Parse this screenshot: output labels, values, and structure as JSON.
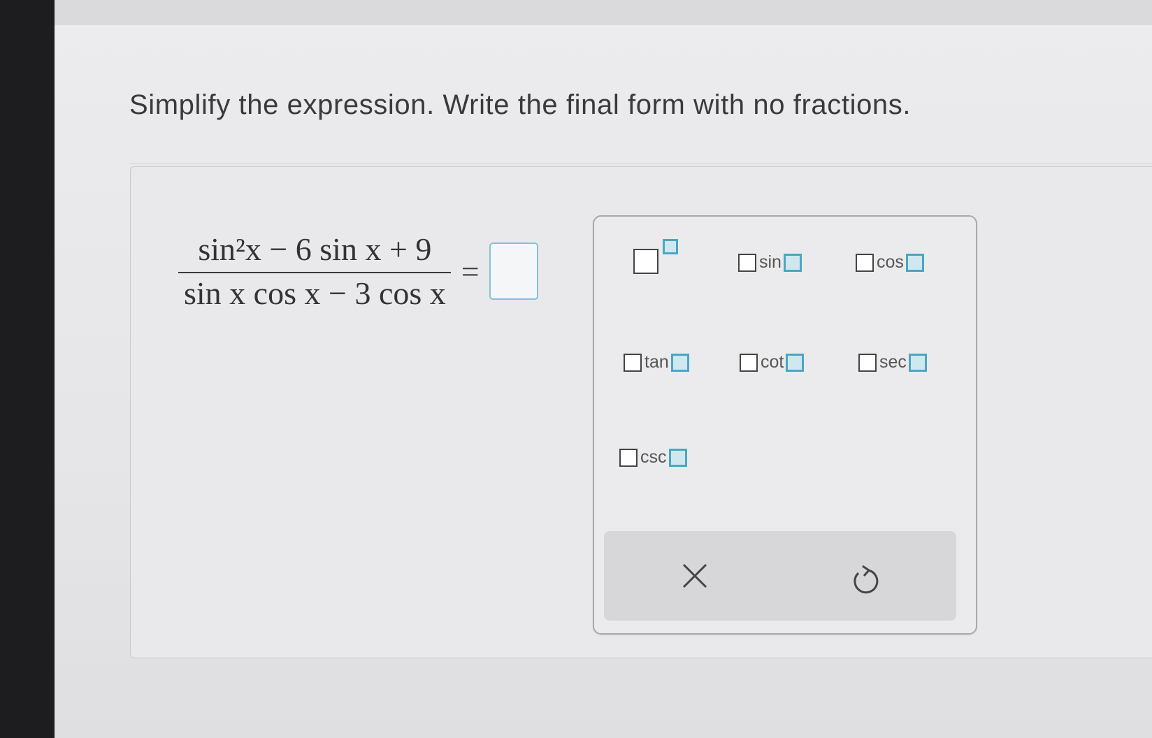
{
  "question": {
    "prompt": "Simplify the expression. Write the final form with no fractions."
  },
  "expression": {
    "numerator": "sin²x − 6 sin x + 9",
    "denominator": "sin x cos x − 3 cos x",
    "equals": "=",
    "answer_value": ""
  },
  "palette": {
    "keys": [
      {
        "id": "power",
        "label": ""
      },
      {
        "id": "sin",
        "label": "sin"
      },
      {
        "id": "cos",
        "label": "cos"
      },
      {
        "id": "tan",
        "label": "tan"
      },
      {
        "id": "cot",
        "label": "cot"
      },
      {
        "id": "sec",
        "label": "sec"
      },
      {
        "id": "csc",
        "label": "csc"
      }
    ],
    "actions": [
      {
        "id": "clear",
        "icon": "close-icon"
      },
      {
        "id": "undo",
        "icon": "undo-icon"
      }
    ]
  },
  "colors": {
    "input_border": "#7fc3d6",
    "slot_fill": "#cfe7ef",
    "slot_border": "#4aa6c3",
    "text": "#3a3a3c"
  }
}
